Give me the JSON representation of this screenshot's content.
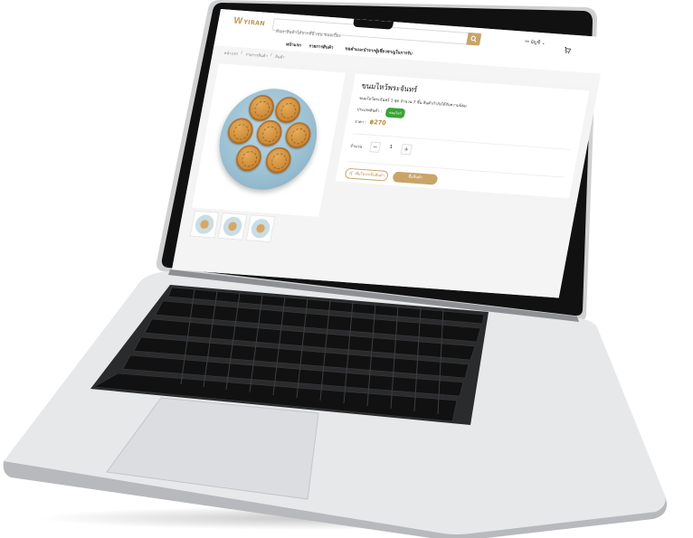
{
  "header": {
    "logo_mark": "W",
    "logo_text": "YIRAN",
    "search_placeholder": "ค้นหาสินค้าได้จากที่นี่ เช่น ขนมเปี๊ยะ",
    "account_label": "บัญชี"
  },
  "nav": {
    "items": [
      "หน้าแรก",
      "รายการสินค้า",
      "ขอคำแนะนำจากผู้เชี่ยวชาญในการรับ"
    ]
  },
  "breadcrumb": {
    "items": [
      "หน้าแรก",
      "รายการสินค้า",
      "สินค้า"
    ],
    "separator": "/"
  },
  "product": {
    "title": "ขนมไหว้พระจันทร์",
    "description": "ขนมไหว้พระจันทร์ 1 ชุด จำนวน 7 ชิ้น สินค้ากำลังได้รับความนิยม",
    "category_label": "ประเภทสินค้า :",
    "category_badge": "ขนมไหว้",
    "price_label": "ราคา :",
    "price": "฿270",
    "quantity_label": "จำนวน",
    "quantity": "1",
    "minus": "−",
    "plus": "+",
    "add_to_cart_label": "🛒 เพิ่มในรถเข็นสินค้า",
    "buy_label": "ซื้อสินค้า"
  },
  "colors": {
    "accent": "#c8a468",
    "price": "#b98a3d",
    "badge": "#3aa335"
  }
}
